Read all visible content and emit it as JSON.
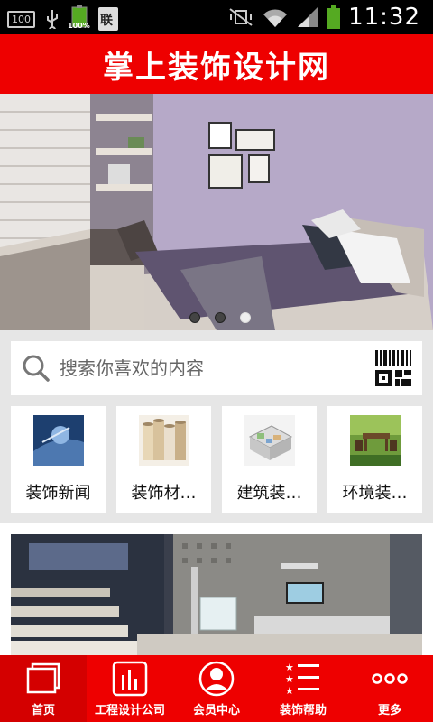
{
  "status_bar": {
    "notification_box": "100",
    "battery_left_label": "100%",
    "doc_icon_label": "联",
    "time": "11:32"
  },
  "header": {
    "title": "掌上装饰设计网"
  },
  "banner": {
    "slide_count": 3,
    "active_slide": 3
  },
  "search": {
    "placeholder": "搜索你喜欢的内容"
  },
  "categories": [
    {
      "label": "装饰新闻",
      "icon": "news-thumbnail"
    },
    {
      "label": "装饰材…",
      "icon": "rolls-thumbnail"
    },
    {
      "label": "建筑装…",
      "icon": "floorplan-thumbnail"
    },
    {
      "label": "环境装…",
      "icon": "garden-thumbnail"
    }
  ],
  "tabbar": {
    "items": [
      {
        "label": "首页",
        "icon": "home-windows-icon",
        "active": true
      },
      {
        "label": "工程设计公司",
        "icon": "chart-icon",
        "active": false
      },
      {
        "label": "会员中心",
        "icon": "user-icon",
        "active": false
      },
      {
        "label": "装饰帮助",
        "icon": "star-list-icon",
        "active": false
      },
      {
        "label": "更多",
        "icon": "more-dots-icon",
        "active": false
      }
    ]
  },
  "colors": {
    "brand_red": "#ee0000",
    "active_tab": "#d40000"
  }
}
